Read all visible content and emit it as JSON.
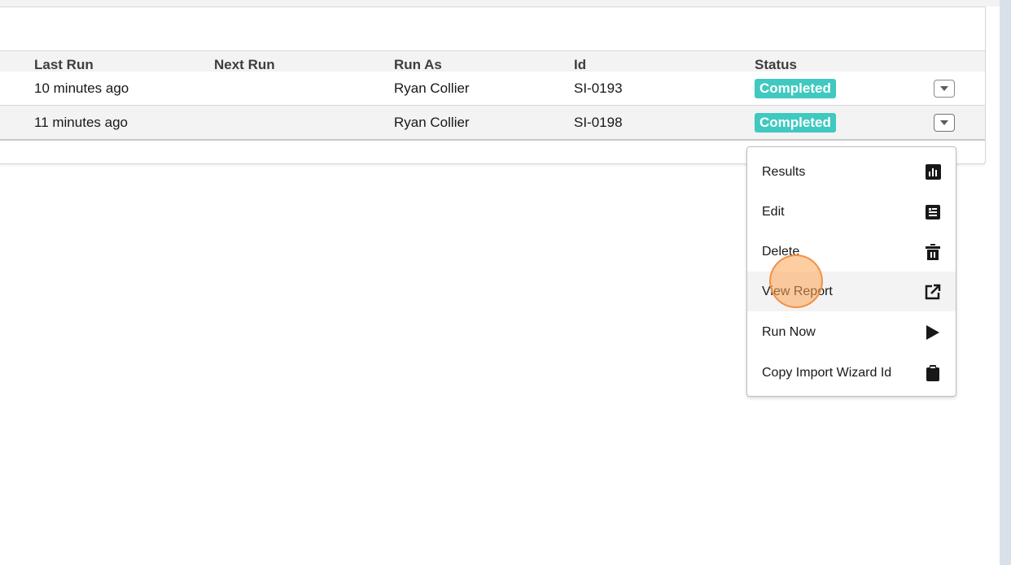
{
  "table": {
    "columns": [
      "Last Run",
      "Next Run",
      "Run As",
      "Id",
      "Status"
    ],
    "rows": [
      {
        "last_run": "10 minutes ago",
        "next_run": "",
        "run_as": "Ryan Collier",
        "id": "SI-0193",
        "status": "Completed"
      },
      {
        "last_run": "11 minutes ago",
        "next_run": "",
        "run_as": "Ryan Collier",
        "id": "SI-0198",
        "status": "Completed"
      }
    ]
  },
  "menu": {
    "items": [
      {
        "label": "Results",
        "icon": "bar-chart-icon"
      },
      {
        "label": "Edit",
        "icon": "edit-form-icon"
      },
      {
        "label": "Delete",
        "icon": "trash-icon"
      },
      {
        "label": "View Report",
        "icon": "external-link-icon"
      },
      {
        "label": "Run Now",
        "icon": "play-icon"
      },
      {
        "label": "Copy Import Wizard Id",
        "icon": "clipboard-icon"
      }
    ]
  },
  "colors": {
    "status_badge": "#3fc9c0",
    "hover": "#f3f3f3",
    "cursor": "#ffa456"
  }
}
